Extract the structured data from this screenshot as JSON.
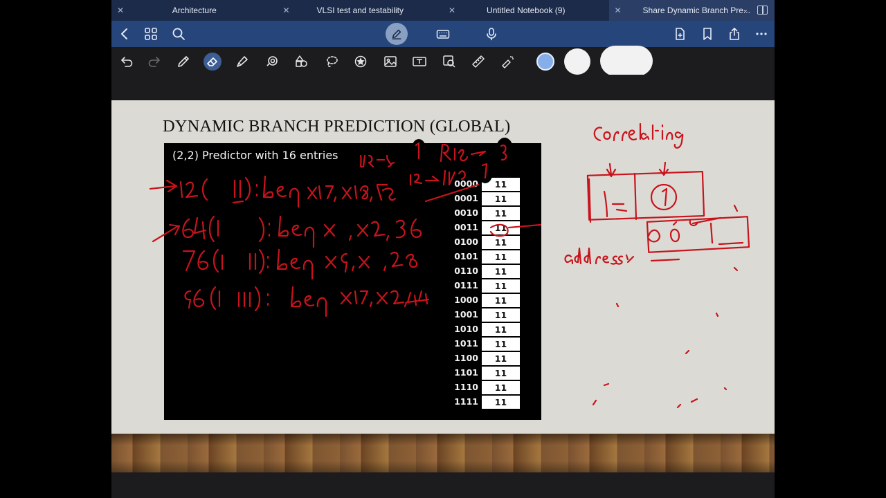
{
  "tabs": [
    {
      "title": "Architecture"
    },
    {
      "title": "VLSI test and testability"
    },
    {
      "title": "Untitled Notebook (9)"
    },
    {
      "title": "Share Dynamic Branch Pre..."
    }
  ],
  "nav_icons": [
    "back-icon",
    "grid-icon",
    "search-icon",
    "pen-mode-icon",
    "keyboard-icon",
    "microphone-icon",
    "add-page-icon",
    "bookmark-icon",
    "share-icon",
    "more-icon"
  ],
  "tool_icons": [
    "undo-icon",
    "redo-icon",
    "pen-icon",
    "eraser-icon",
    "highlighter-icon",
    "shape-icon",
    "lasso-icon",
    "elements-icon",
    "sticker-icon",
    "image-icon",
    "text-icon",
    "scan-icon",
    "ruler-icon",
    "laser-pointer-icon"
  ],
  "colors": {
    "ink": "#c8131c",
    "accent": "#26457a",
    "tab_bar": "#1c2b4a",
    "swatch_blue": "#86aee8"
  },
  "slide": {
    "title": "DYNAMIC BRANCH PREDICTION (GLOBAL)",
    "subtitle": "(2,2) Predictor with 16 entries",
    "rows": [
      {
        "index": "0000",
        "value": "11"
      },
      {
        "index": "0001",
        "value": "11"
      },
      {
        "index": "0010",
        "value": "11"
      },
      {
        "index": "0011",
        "value": "11"
      },
      {
        "index": "0100",
        "value": "11"
      },
      {
        "index": "0101",
        "value": "11"
      },
      {
        "index": "0110",
        "value": "11"
      },
      {
        "index": "0111",
        "value": "11"
      },
      {
        "index": "1000",
        "value": "11"
      },
      {
        "index": "1001",
        "value": "11"
      },
      {
        "index": "1010",
        "value": "11"
      },
      {
        "index": "1011",
        "value": "11"
      },
      {
        "index": "1100",
        "value": "11"
      },
      {
        "index": "1101",
        "value": "11"
      },
      {
        "index": "1110",
        "value": "11"
      },
      {
        "index": "1111",
        "value": "11"
      }
    ]
  }
}
